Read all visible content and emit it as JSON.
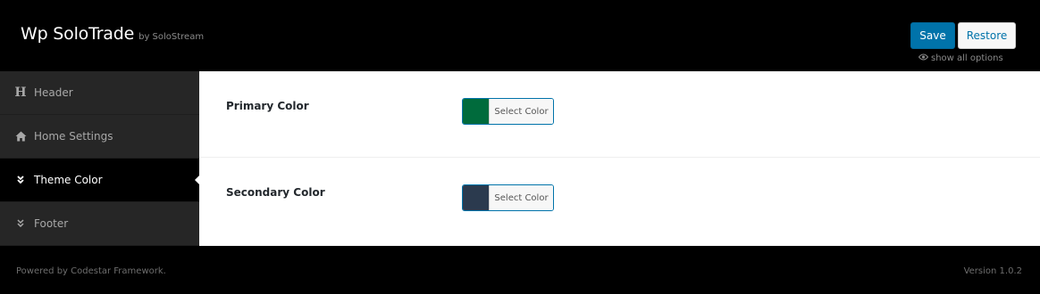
{
  "header": {
    "title": "Wp SoloTrade",
    "by": "by SoloStream",
    "save_label": "Save",
    "restore_label": "Restore",
    "show_all_label": "show all options"
  },
  "sidebar": {
    "items": [
      {
        "label": "Header",
        "icon": "heading-icon",
        "active": false
      },
      {
        "label": "Home Settings",
        "icon": "home-icon",
        "active": false
      },
      {
        "label": "Theme Color",
        "icon": "chevron-double-down-icon",
        "active": true
      },
      {
        "label": "Footer",
        "icon": "chevron-double-down-icon",
        "active": false
      }
    ]
  },
  "fields": [
    {
      "label": "Primary Color",
      "button_label": "Select Color",
      "color": "#006b3c"
    },
    {
      "label": "Secondary Color",
      "button_label": "Select Color",
      "color": "#2b3a4e"
    }
  ],
  "footer": {
    "powered_by": "Powered by Codestar Framework.",
    "version": "Version 1.0.2"
  },
  "colors": {
    "accent": "#0073aa",
    "background": "#000000",
    "sidebar": "#262626"
  }
}
